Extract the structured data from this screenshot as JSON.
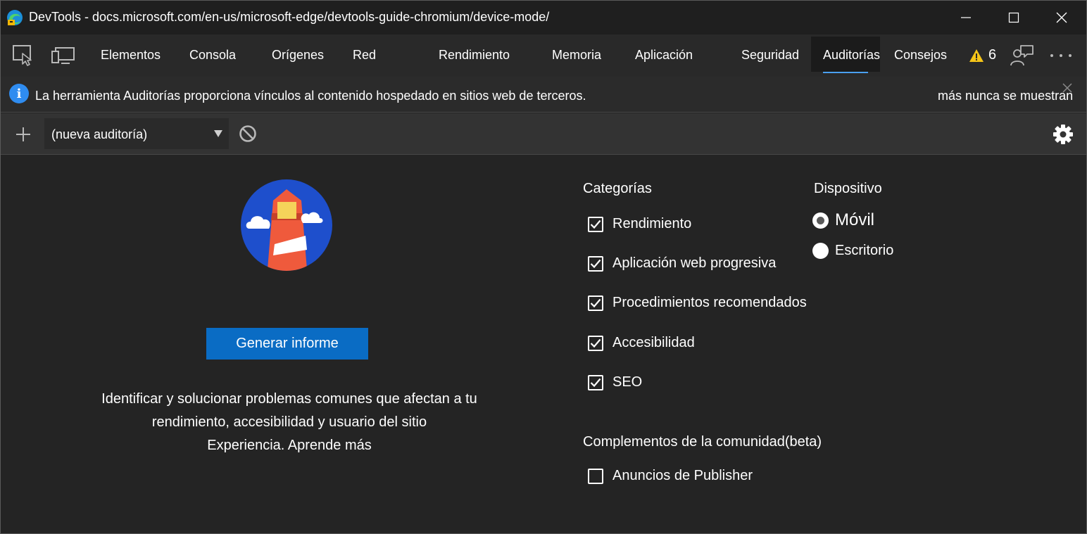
{
  "window": {
    "title": "DevTools - docs.microsoft.com/en-us/microsoft-edge/devtools-guide-chromium/device-mode/"
  },
  "tabs": [
    {
      "label": "Elementos"
    },
    {
      "label": "Consola"
    },
    {
      "label": "Orígenes"
    },
    {
      "label": "Red"
    },
    {
      "label": "Rendimiento"
    },
    {
      "label": "Memoria"
    },
    {
      "label": "Aplicación"
    },
    {
      "label": "Seguridad"
    },
    {
      "label": "Auditorías",
      "active": true
    },
    {
      "label": "Consejos"
    }
  ],
  "issues": {
    "count": "6"
  },
  "infobar": {
    "message": "La herramienta Auditorías proporciona vínculos al contenido hospedado en sitios web de terceros.",
    "dismiss_label": "más nunca se muestran"
  },
  "toolbar": {
    "audit_select_value": "(nueva auditoría)"
  },
  "main": {
    "generate_label": "Generar informe",
    "description_lines": [
      "Identificar y solucionar problemas comunes que afectan a tu",
      "rendimiento, accesibilidad y usuario del sitio",
      "Experiencia. Aprende más"
    ]
  },
  "categories": {
    "title": "Categorías",
    "items": [
      {
        "label": "Rendimiento",
        "checked": true
      },
      {
        "label": "Aplicación web progresiva",
        "checked": true
      },
      {
        "label": "Procedimientos recomendados",
        "checked": true
      },
      {
        "label": "Accesibilidad",
        "checked": true
      },
      {
        "label": "SEO",
        "checked": true
      }
    ]
  },
  "device": {
    "title": "Dispositivo",
    "options": [
      {
        "label": "Móvil",
        "selected": true
      },
      {
        "label": "Escritorio",
        "selected": false
      }
    ]
  },
  "plugins": {
    "title": "Complementos de la comunidad(beta)",
    "items": [
      {
        "label": "Anuncios de Publisher",
        "checked": false
      }
    ]
  },
  "colors": {
    "accent": "#0a6cc4",
    "active_tab_underline": "#4aa0f0",
    "info_icon": "#2f8cf0",
    "warning": "#f5c518",
    "background": "#242424"
  },
  "icons": {
    "app": "edge-browser-icon",
    "inspect": "inspect-element-icon",
    "device": "device-emulation-icon",
    "warning": "warning-triangle-icon",
    "feedback": "feedback-icon",
    "more": "more-options-icon",
    "info": "info-icon",
    "close": "close-icon",
    "add": "plus-icon",
    "clear": "clear-block-icon",
    "settings": "gear-icon",
    "logo": "lighthouse-logo"
  }
}
